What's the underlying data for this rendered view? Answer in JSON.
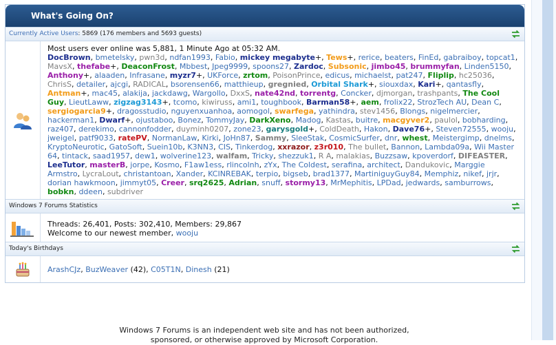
{
  "header": {
    "title": "What's Going On?"
  },
  "active_users": {
    "label": "Currently Active Users",
    "summary": ": 5869 (176 members and 5693 guests)",
    "max_line": "Most users ever online was 5,881, 1 Minute Ago at 05:32 AM.",
    "users": [
      {
        "n": "DocBrown",
        "c": "u-navy"
      },
      {
        "n": "bmetelsky",
        "c": "u-n"
      },
      {
        "n": "pwn3d",
        "c": "u-gray"
      },
      {
        "n": "ndfan1993",
        "c": "u-n"
      },
      {
        "n": "Fabio",
        "c": "u-n"
      },
      {
        "n": "mickey megabyte",
        "c": "u-navy",
        "p": true
      },
      {
        "n": "Tews",
        "c": "u-orange",
        "p": true
      },
      {
        "n": "rerice",
        "c": "u-n"
      },
      {
        "n": "beaters",
        "c": "u-n"
      },
      {
        "n": "FinEd",
        "c": "u-n"
      },
      {
        "n": "gabraiboy",
        "c": "u-n"
      },
      {
        "n": "topcat1",
        "c": "u-n"
      },
      {
        "n": "MavsX",
        "c": "u-gray"
      },
      {
        "n": "thefabe",
        "c": "u-purple",
        "p": true
      },
      {
        "n": "DeaconFrost",
        "c": "u-green"
      },
      {
        "n": "Mbbest",
        "c": "u-n"
      },
      {
        "n": "Jpeg9999",
        "c": "u-n"
      },
      {
        "n": "spoons27",
        "c": "u-n"
      },
      {
        "n": "Zardoc",
        "c": "u-navy"
      },
      {
        "n": "Subsonic",
        "c": "u-orange"
      },
      {
        "n": "jimbo45",
        "c": "u-purple"
      },
      {
        "n": "brummyfan",
        "c": "u-purple"
      },
      {
        "n": "Linden5150",
        "c": "u-n"
      },
      {
        "n": "Anthony",
        "c": "u-purple",
        "p": true
      },
      {
        "n": "alaaden",
        "c": "u-n"
      },
      {
        "n": "Infrasane",
        "c": "u-n"
      },
      {
        "n": "myzr7",
        "c": "u-navy",
        "p": true
      },
      {
        "n": "UKForce",
        "c": "u-n"
      },
      {
        "n": "zrtom",
        "c": "u-green"
      },
      {
        "n": "PoisonPrince",
        "c": "u-gray"
      },
      {
        "n": "edicus",
        "c": "u-n"
      },
      {
        "n": "michaelst",
        "c": "u-n"
      },
      {
        "n": "pat247",
        "c": "u-n"
      },
      {
        "n": "Fliplip",
        "c": "u-green"
      },
      {
        "n": "hc25036",
        "c": "u-gray"
      },
      {
        "n": "ChrisS",
        "c": "u-gray"
      },
      {
        "n": "detailer",
        "c": "u-n"
      },
      {
        "n": "ajcgi",
        "c": "u-n"
      },
      {
        "n": "RADICAL",
        "c": "u-gray"
      },
      {
        "n": "bsorensen66",
        "c": "u-n"
      },
      {
        "n": "matthieup",
        "c": "u-n"
      },
      {
        "n": "gregnied",
        "c": "u-grayb"
      },
      {
        "n": "Orbital Shark",
        "c": "u-cyan",
        "p": true
      },
      {
        "n": "siouxdax",
        "c": "u-n"
      },
      {
        "n": "Kari",
        "c": "u-navy",
        "p": true
      },
      {
        "n": "qantasfly",
        "c": "u-n"
      },
      {
        "n": "Antman",
        "c": "u-orange",
        "p": true
      },
      {
        "n": "mac45",
        "c": "u-n"
      },
      {
        "n": "alakija",
        "c": "u-n"
      },
      {
        "n": "jackdawg",
        "c": "u-n"
      },
      {
        "n": "Wargollo",
        "c": "u-n"
      },
      {
        "n": "DxxS",
        "c": "u-gray"
      },
      {
        "n": "nate42nd",
        "c": "u-purple"
      },
      {
        "n": "torrentg",
        "c": "u-purple"
      },
      {
        "n": "Concker",
        "c": "u-n"
      },
      {
        "n": "djmorgan",
        "c": "u-gray"
      },
      {
        "n": "trashpants",
        "c": "u-gray"
      },
      {
        "n": "The Cool Guy",
        "c": "u-green"
      },
      {
        "n": "LieutLaww",
        "c": "u-n"
      },
      {
        "n": "zigzag3143",
        "c": "u-cyan",
        "p": true
      },
      {
        "n": "tcomo",
        "c": "u-n"
      },
      {
        "n": "kiwiruss",
        "c": "u-gray"
      },
      {
        "n": "ami1",
        "c": "u-n"
      },
      {
        "n": "toughbook",
        "c": "u-n"
      },
      {
        "n": "Barman58",
        "c": "u-navy",
        "p": true
      },
      {
        "n": "aem",
        "c": "u-green"
      },
      {
        "n": "frolix22",
        "c": "u-n"
      },
      {
        "n": "StrozTech AU",
        "c": "u-n"
      },
      {
        "n": "Dean C",
        "c": "u-n"
      },
      {
        "n": "sergiogarcia9",
        "c": "u-orange",
        "p": true
      },
      {
        "n": "dragosstudio",
        "c": "u-n"
      },
      {
        "n": "nguyenxuanhoa",
        "c": "u-n"
      },
      {
        "n": "aomogol",
        "c": "u-n"
      },
      {
        "n": "swarfega",
        "c": "u-orange"
      },
      {
        "n": "yathindra",
        "c": "u-n"
      },
      {
        "n": "stev1456",
        "c": "u-gray"
      },
      {
        "n": "Blongs",
        "c": "u-n"
      },
      {
        "n": "nigelmercier",
        "c": "u-n"
      },
      {
        "n": "hackerman1",
        "c": "u-n"
      },
      {
        "n": "Dwarf",
        "c": "u-navy",
        "p": true
      },
      {
        "n": "ojustaboo",
        "c": "u-n"
      },
      {
        "n": "Bonez",
        "c": "u-n"
      },
      {
        "n": "TommyJay",
        "c": "u-n"
      },
      {
        "n": "DarkXeno",
        "c": "u-green"
      },
      {
        "n": "Madog",
        "c": "u-n"
      },
      {
        "n": "Kastas",
        "c": "u-gray"
      },
      {
        "n": "buitre",
        "c": "u-n"
      },
      {
        "n": "macgyver2",
        "c": "u-orange"
      },
      {
        "n": "paulol",
        "c": "u-gray"
      },
      {
        "n": "bobharding",
        "c": "u-n"
      },
      {
        "n": "raz407",
        "c": "u-n"
      },
      {
        "n": "derekimo",
        "c": "u-n"
      },
      {
        "n": "cannonfodder",
        "c": "u-n"
      },
      {
        "n": "duyminh0207",
        "c": "u-gray"
      },
      {
        "n": "zone23",
        "c": "u-n"
      },
      {
        "n": "garysgold",
        "c": "u-teal",
        "p": true
      },
      {
        "n": "ColdDeath",
        "c": "u-gray"
      },
      {
        "n": "Hakon",
        "c": "u-n"
      },
      {
        "n": "Dave76",
        "c": "u-navy",
        "p": true
      },
      {
        "n": "Steven72555",
        "c": "u-n"
      },
      {
        "n": "wooju",
        "c": "u-n"
      },
      {
        "n": "jweigel",
        "c": "u-n"
      },
      {
        "n": "patf9033",
        "c": "u-n"
      },
      {
        "n": "ratePV",
        "c": "u-red"
      },
      {
        "n": "NormanLaw",
        "c": "u-n"
      },
      {
        "n": "Kirki",
        "c": "u-n"
      },
      {
        "n": "JoHn87",
        "c": "u-n"
      },
      {
        "n": "Sammy",
        "c": "u-grayb"
      },
      {
        "n": "SleeStak",
        "c": "u-n"
      },
      {
        "n": "CosmicSurfer",
        "c": "u-n"
      },
      {
        "n": "dnr",
        "c": "u-n"
      },
      {
        "n": "whest",
        "c": "u-green"
      },
      {
        "n": "Meistergimp",
        "c": "u-n"
      },
      {
        "n": "dnelms",
        "c": "u-n"
      },
      {
        "n": "KryptoNeurotic",
        "c": "u-n"
      },
      {
        "n": "GatoSoft",
        "c": "u-n"
      },
      {
        "n": "Suein10b",
        "c": "u-n"
      },
      {
        "n": "K3NN3",
        "c": "u-n"
      },
      {
        "n": "CIS",
        "c": "u-n"
      },
      {
        "n": "Tinkerdog",
        "c": "u-n"
      },
      {
        "n": "xxrazor",
        "c": "u-dkred"
      },
      {
        "n": "z3r010",
        "c": "u-red"
      },
      {
        "n": "The bullet",
        "c": "u-gray"
      },
      {
        "n": "Bannon",
        "c": "u-n"
      },
      {
        "n": "Lambda09a",
        "c": "u-n"
      },
      {
        "n": "Wii Master 64",
        "c": "u-n"
      },
      {
        "n": "tintack",
        "c": "u-n"
      },
      {
        "n": "saad1957",
        "c": "u-n"
      },
      {
        "n": "dew1",
        "c": "u-n"
      },
      {
        "n": "wolverine123",
        "c": "u-n"
      },
      {
        "n": "walfam",
        "c": "u-grayb"
      },
      {
        "n": "Tricky",
        "c": "u-n"
      },
      {
        "n": "shezzuk1",
        "c": "u-n"
      },
      {
        "n": "R A",
        "c": "u-gray"
      },
      {
        "n": "malakias",
        "c": "u-gray"
      },
      {
        "n": "Buzzsaw",
        "c": "u-n"
      },
      {
        "n": "kpoverdorf",
        "c": "u-n"
      },
      {
        "n": "DIFEASTER",
        "c": "u-grayb"
      },
      {
        "n": "LeeTutor",
        "c": "u-navy"
      },
      {
        "n": "masterB",
        "c": "u-purple"
      },
      {
        "n": "jorpe",
        "c": "u-n"
      },
      {
        "n": "Kosmo",
        "c": "u-n"
      },
      {
        "n": "F1aw1ess",
        "c": "u-n"
      },
      {
        "n": "rlincolnh",
        "c": "u-n"
      },
      {
        "n": "zYx",
        "c": "u-n"
      },
      {
        "n": "The Coldest",
        "c": "u-n"
      },
      {
        "n": "serafina",
        "c": "u-n"
      },
      {
        "n": "architect",
        "c": "u-n"
      },
      {
        "n": "Dandukovic",
        "c": "u-gray"
      },
      {
        "n": "Marggie Armstro",
        "c": "u-n"
      },
      {
        "n": "LycraLout",
        "c": "u-gray"
      },
      {
        "n": "christantoan",
        "c": "u-n"
      },
      {
        "n": "Xander",
        "c": "u-n"
      },
      {
        "n": "KCINREBAK",
        "c": "u-n"
      },
      {
        "n": "terpio",
        "c": "u-n"
      },
      {
        "n": "bigseb",
        "c": "u-n"
      },
      {
        "n": "brad1377",
        "c": "u-n"
      },
      {
        "n": "MartiniguyGuy84",
        "c": "u-n"
      },
      {
        "n": "Memphiz",
        "c": "u-n"
      },
      {
        "n": "nikef",
        "c": "u-n"
      },
      {
        "n": "jrjr",
        "c": "u-n"
      },
      {
        "n": "dorian hawkmoon",
        "c": "u-n"
      },
      {
        "n": "jimmyt05",
        "c": "u-n"
      },
      {
        "n": "Creer",
        "c": "u-purple"
      },
      {
        "n": "srq2625",
        "c": "u-green"
      },
      {
        "n": "Adrian",
        "c": "u-green"
      },
      {
        "n": "snuff",
        "c": "u-n"
      },
      {
        "n": "stormy13",
        "c": "u-purple"
      },
      {
        "n": "MrMephitis",
        "c": "u-n"
      },
      {
        "n": "LPDad",
        "c": "u-n"
      },
      {
        "n": "jedwards",
        "c": "u-n"
      },
      {
        "n": "samburrows",
        "c": "u-n"
      },
      {
        "n": "bobkn",
        "c": "u-green"
      },
      {
        "n": "ddeen",
        "c": "u-n"
      },
      {
        "n": "subdriver",
        "c": "u-gray"
      }
    ]
  },
  "stats": {
    "label": "Windows 7 Forums Statistics",
    "line": "Threads: 26,401, Posts: 302,410, Members: 29,867",
    "welcome": "Welcome to our newest member, ",
    "newest": "wooju"
  },
  "birthdays": {
    "label": "Today's Birthdays",
    "entries": [
      {
        "name": "ArashCJz",
        "age": ""
      },
      {
        "name": "BuzWeaver",
        "age": " (42)"
      },
      {
        "name": "C05T1N",
        "age": ""
      },
      {
        "name": "Dinesh",
        "age": " (21)"
      }
    ]
  },
  "footer": {
    "line1": "Windows 7 Forums is an independent web site and has not been authorized,",
    "line2": "sponsored, or otherwise approved by Microsoft Corporation."
  },
  "icons": [
    "refresh-icon",
    "users-icon",
    "stats-icon",
    "birthday-cake-icon"
  ],
  "colors": {
    "header_bg": "#1f4a7c",
    "link": "#3b6fb4",
    "strip_bg": "#e6eef8"
  }
}
